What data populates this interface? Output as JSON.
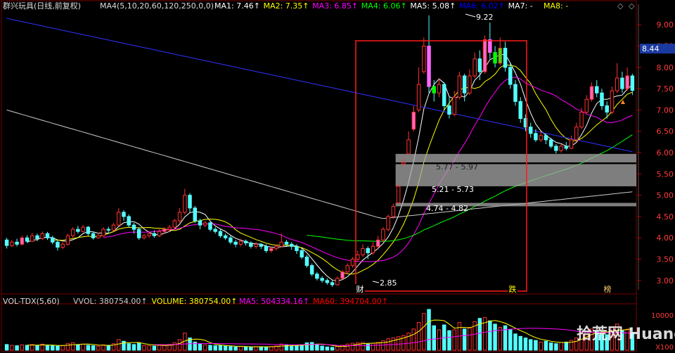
{
  "chart_data": {
    "type": "candlestick",
    "header": {
      "stock": "群兴玩具(日线,前复权)",
      "ma_def": "MA4(5,10,20,60,120,250,0,0)",
      "mas": [
        {
          "label": "MA1: 7.46",
          "color": "#ffffff"
        },
        {
          "label": "MA2: 7.35",
          "color": "#ffff00"
        },
        {
          "label": "MA3: 6.85",
          "color": "#ff00ff"
        },
        {
          "label": "MA4: 6.06",
          "color": "#00ff00"
        },
        {
          "label": "MA5: 5.08",
          "color": "#ffffff"
        },
        {
          "label": "MA6: 6.02",
          "color": "#0000ff"
        },
        {
          "label": "MA7: -",
          "color": "#ffffff"
        },
        {
          "label": "MA8: -",
          "color": "#ffff00"
        }
      ]
    },
    "price_axis": {
      "min": 2.75,
      "max": 9.35,
      "ticks": [
        "9.00",
        "8.50",
        "8.00",
        "7.50",
        "7.00",
        "6.50",
        "6.00",
        "5.50",
        "5.00",
        "4.50",
        "4.00",
        "3.50",
        "3.00"
      ],
      "current": "8.44"
    },
    "annotations": {
      "high": "9.22",
      "low": "2.85",
      "gap1": "5.77 - 5.97",
      "gap2": "5.21 - 5.73",
      "gap3": "4.74 - 4.82"
    },
    "markers": [
      "财",
      "跌",
      "榜"
    ],
    "volume_header": {
      "name": "VOL-TDX(5,60)",
      "items": [
        {
          "label": "VVOL: 380754.00",
          "color": "#cccccc"
        },
        {
          "label": "VOLUME: 380754.00",
          "color": "#ffff00"
        },
        {
          "label": "MA5: 504334.16",
          "color": "#ff00ff"
        },
        {
          "label": "MA60: 394704.00",
          "color": "#ff0000"
        }
      ]
    },
    "volume_axis": {
      "tick": "10000",
      "unit": "X100"
    },
    "watermark": "拾荒网 Huang.CN",
    "candles": [
      [
        3.95,
        3.82,
        4.0,
        3.75
      ],
      [
        3.82,
        3.9,
        3.95,
        3.78
      ],
      [
        3.9,
        3.85,
        3.98,
        3.8
      ],
      [
        3.85,
        4.0,
        4.05,
        3.82
      ],
      [
        4.0,
        3.92,
        4.06,
        3.88
      ],
      [
        3.92,
        4.05,
        4.12,
        3.9
      ],
      [
        4.05,
        3.98,
        4.1,
        3.92
      ],
      [
        3.98,
        4.1,
        4.15,
        3.95
      ],
      [
        4.1,
        4.0,
        4.14,
        3.95
      ],
      [
        4.0,
        3.9,
        4.05,
        3.85
      ],
      [
        3.9,
        3.78,
        3.95,
        3.7
      ],
      [
        3.78,
        3.85,
        3.9,
        3.74
      ],
      [
        3.85,
        4.05,
        4.1,
        3.82
      ],
      [
        4.05,
        4.2,
        4.25,
        4.0
      ],
      [
        4.2,
        4.15,
        4.28,
        4.1
      ],
      [
        4.15,
        4.25,
        4.3,
        4.12
      ],
      [
        4.25,
        4.1,
        4.28,
        4.05
      ],
      [
        4.1,
        4.0,
        4.15,
        3.96
      ],
      [
        4.0,
        4.05,
        4.12,
        3.98
      ],
      [
        4.05,
        4.2,
        4.25,
        4.02
      ],
      [
        4.2,
        4.18,
        4.26,
        4.1
      ],
      [
        4.18,
        4.3,
        4.35,
        4.15
      ],
      [
        4.3,
        4.6,
        4.7,
        4.28
      ],
      [
        4.6,
        4.5,
        4.65,
        4.4
      ],
      [
        4.5,
        4.3,
        4.55,
        4.25
      ],
      [
        4.3,
        4.2,
        4.35,
        4.1
      ],
      [
        4.2,
        4.0,
        4.25,
        3.95
      ],
      [
        4.0,
        4.05,
        4.1,
        3.96
      ],
      [
        4.05,
        4.1,
        4.15,
        4.0
      ],
      [
        4.1,
        4.05,
        4.18,
        4.0
      ],
      [
        4.05,
        4.15,
        4.2,
        4.02
      ],
      [
        4.15,
        4.2,
        4.25,
        4.1
      ],
      [
        4.2,
        4.25,
        4.3,
        4.15
      ],
      [
        4.25,
        4.4,
        4.45,
        4.2
      ],
      [
        4.4,
        4.6,
        4.7,
        4.35
      ],
      [
        4.6,
        5.0,
        5.15,
        4.55
      ],
      [
        5.0,
        4.7,
        5.05,
        4.6
      ],
      [
        4.7,
        4.4,
        4.75,
        4.35
      ],
      [
        4.4,
        4.3,
        4.45,
        4.2
      ],
      [
        4.3,
        4.35,
        4.4,
        4.25
      ],
      [
        4.35,
        4.2,
        4.4,
        4.15
      ],
      [
        4.2,
        4.15,
        4.25,
        4.1
      ],
      [
        4.15,
        4.05,
        4.2,
        4.0
      ],
      [
        4.05,
        4.0,
        4.1,
        3.95
      ],
      [
        4.0,
        3.9,
        4.05,
        3.85
      ],
      [
        3.9,
        3.85,
        3.95,
        3.78
      ],
      [
        3.85,
        3.92,
        3.98,
        3.8
      ],
      [
        3.92,
        3.88,
        3.96,
        3.82
      ],
      [
        3.88,
        3.8,
        3.92,
        3.75
      ],
      [
        3.8,
        3.85,
        3.9,
        3.75
      ],
      [
        3.85,
        3.8,
        3.88,
        3.74
      ],
      [
        3.8,
        3.7,
        3.85,
        3.65
      ],
      [
        3.7,
        3.75,
        3.8,
        3.65
      ],
      [
        3.75,
        3.8,
        3.85,
        3.7
      ],
      [
        3.8,
        3.9,
        4.1,
        3.78
      ],
      [
        3.9,
        3.85,
        3.95,
        3.8
      ],
      [
        3.85,
        3.8,
        3.9,
        3.72
      ],
      [
        3.8,
        3.7,
        3.85,
        3.62
      ],
      [
        3.7,
        3.55,
        3.75,
        3.5
      ],
      [
        3.55,
        3.35,
        3.6,
        3.3
      ],
      [
        3.35,
        3.15,
        3.4,
        3.1
      ],
      [
        3.15,
        3.05,
        3.2,
        3.0
      ],
      [
        3.05,
        3.0,
        3.1,
        2.95
      ],
      [
        3.0,
        2.95,
        3.05,
        2.9
      ],
      [
        2.95,
        2.9,
        3.0,
        2.85
      ],
      [
        2.9,
        3.05,
        3.1,
        2.88
      ],
      [
        3.05,
        3.2,
        3.25,
        3.02
      ],
      [
        3.2,
        3.35,
        3.4,
        3.15
      ],
      [
        3.35,
        3.5,
        3.55,
        3.3
      ],
      [
        3.5,
        3.6,
        3.7,
        3.45
      ],
      [
        3.6,
        3.75,
        3.85,
        3.55
      ],
      [
        3.75,
        3.65,
        3.8,
        3.5
      ],
      [
        3.65,
        3.8,
        3.9,
        3.6
      ],
      [
        3.8,
        3.95,
        4.05,
        3.75
      ],
      [
        3.95,
        4.2,
        4.25,
        3.9
      ],
      [
        4.2,
        4.5,
        4.55,
        4.15
      ],
      [
        4.5,
        4.74,
        4.8,
        4.45
      ],
      [
        4.82,
        5.21,
        5.25,
        4.82
      ],
      [
        5.73,
        5.77,
        5.85,
        5.7
      ],
      [
        5.97,
        6.3,
        6.5,
        5.95
      ],
      [
        6.55,
        6.95,
        7.1,
        6.5
      ],
      [
        7.0,
        7.6,
        8.0,
        6.95
      ],
      [
        7.9,
        8.5,
        8.7,
        7.85
      ],
      [
        8.5,
        7.55,
        9.22,
        7.4
      ],
      [
        7.55,
        7.4,
        7.7,
        7.2
      ],
      [
        7.4,
        7.6,
        7.75,
        7.3
      ],
      [
        7.6,
        7.1,
        7.65,
        7.0
      ],
      [
        7.1,
        6.9,
        7.3,
        6.8
      ],
      [
        6.9,
        7.3,
        7.45,
        6.85
      ],
      [
        7.3,
        7.8,
        7.9,
        7.25
      ],
      [
        7.8,
        7.4,
        7.85,
        7.2
      ],
      [
        7.4,
        7.8,
        7.95,
        7.35
      ],
      [
        7.8,
        8.2,
        8.35,
        7.75
      ],
      [
        8.2,
        7.9,
        8.4,
        7.7
      ],
      [
        7.9,
        8.65,
        8.75,
        7.85
      ],
      [
        8.65,
        8.35,
        9.05,
        8.2
      ],
      [
        8.35,
        8.1,
        8.5,
        8.0
      ],
      [
        8.1,
        8.45,
        8.7,
        8.05
      ],
      [
        8.45,
        8.0,
        8.6,
        7.9
      ],
      [
        8.0,
        7.6,
        8.1,
        7.5
      ],
      [
        7.6,
        7.2,
        7.7,
        7.1
      ],
      [
        7.2,
        6.8,
        7.3,
        6.7
      ],
      [
        6.8,
        6.6,
        6.9,
        6.5
      ],
      [
        6.6,
        6.45,
        6.7,
        6.35
      ],
      [
        6.45,
        6.3,
        6.55,
        6.25
      ],
      [
        6.3,
        6.4,
        6.5,
        6.25
      ],
      [
        6.4,
        6.3,
        6.45,
        6.2
      ],
      [
        6.3,
        6.15,
        6.35,
        6.1
      ],
      [
        6.15,
        6.05,
        6.2,
        5.98
      ],
      [
        6.05,
        6.15,
        6.2,
        6.0
      ],
      [
        6.15,
        6.1,
        6.25,
        6.05
      ],
      [
        6.1,
        6.3,
        6.4,
        6.08
      ],
      [
        6.3,
        6.6,
        6.7,
        6.25
      ],
      [
        6.6,
        6.95,
        7.05,
        6.55
      ],
      [
        6.95,
        7.25,
        7.35,
        6.9
      ],
      [
        7.25,
        7.55,
        7.65,
        7.2
      ],
      [
        7.55,
        7.4,
        7.7,
        7.3
      ],
      [
        7.4,
        7.1,
        7.5,
        7.0
      ],
      [
        7.1,
        6.95,
        7.2,
        6.8
      ],
      [
        6.95,
        7.45,
        7.55,
        6.9
      ],
      [
        7.45,
        7.75,
        8.1,
        7.4
      ],
      [
        7.75,
        7.5,
        7.9,
        7.4
      ],
      [
        7.5,
        7.8,
        8.0,
        7.45
      ],
      [
        7.8,
        7.46,
        7.85,
        7.35
      ]
    ],
    "volume": [
      140,
      120,
      110,
      130,
      120,
      140,
      110,
      150,
      120,
      110,
      100,
      110,
      160,
      180,
      140,
      150,
      120,
      110,
      100,
      130,
      120,
      160,
      260,
      220,
      160,
      140,
      170,
      120,
      110,
      100,
      120,
      130,
      140,
      180,
      260,
      420,
      300,
      200,
      160,
      130,
      120,
      110,
      120,
      100,
      90,
      80,
      90,
      85,
      80,
      90,
      85,
      80,
      90,
      100,
      150,
      120,
      100,
      110,
      130,
      180,
      190,
      140,
      100,
      80,
      70,
      90,
      120,
      150,
      170,
      180,
      190,
      150,
      170,
      190,
      230,
      280,
      300,
      330,
      360,
      420,
      520,
      680,
      900,
      1000,
      600,
      500,
      620,
      480,
      500,
      680,
      520,
      560,
      700,
      780,
      800,
      720,
      640,
      560,
      600,
      500,
      400,
      340,
      300,
      260,
      240,
      200,
      220,
      180,
      160,
      190,
      200,
      240,
      300,
      400,
      460,
      520,
      470,
      400,
      380,
      560,
      640,
      480,
      500,
      420
    ]
  }
}
